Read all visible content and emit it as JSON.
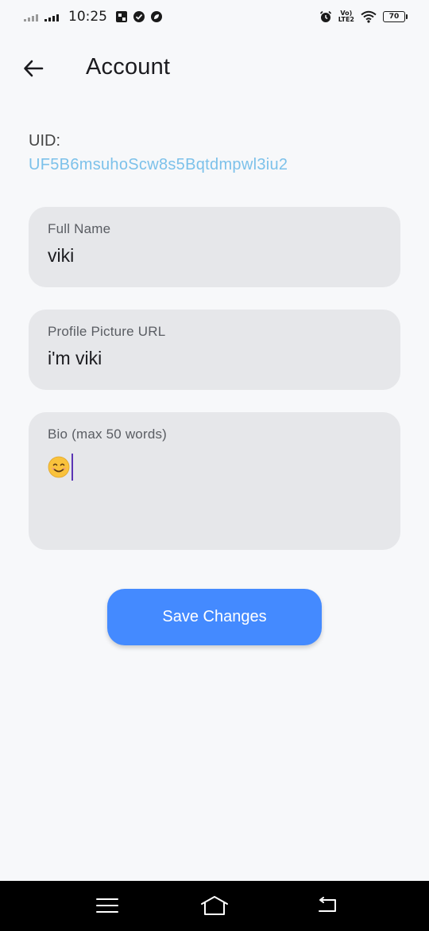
{
  "status_bar": {
    "time": "10:25",
    "battery_level": "70",
    "lte_top": "Vo)",
    "lte_bottom": "LTE2"
  },
  "app_bar": {
    "title": "Account"
  },
  "uid": {
    "label": "UID:",
    "value": "UF5B6msuhoScw8s5Bqtdmpwl3iu2"
  },
  "form": {
    "full_name": {
      "label": "Full Name",
      "value": "viki"
    },
    "profile_picture_url": {
      "label": "Profile Picture URL",
      "value": "i'm viki"
    },
    "bio": {
      "label": "Bio (max 50 words)"
    }
  },
  "actions": {
    "save_label": "Save Changes"
  },
  "colors": {
    "accent": "#448aff",
    "uid_text": "#7cc1ea",
    "field_bg": "#e6e7ea",
    "background": "#f7f8fa",
    "cursor": "#5b35b5"
  }
}
